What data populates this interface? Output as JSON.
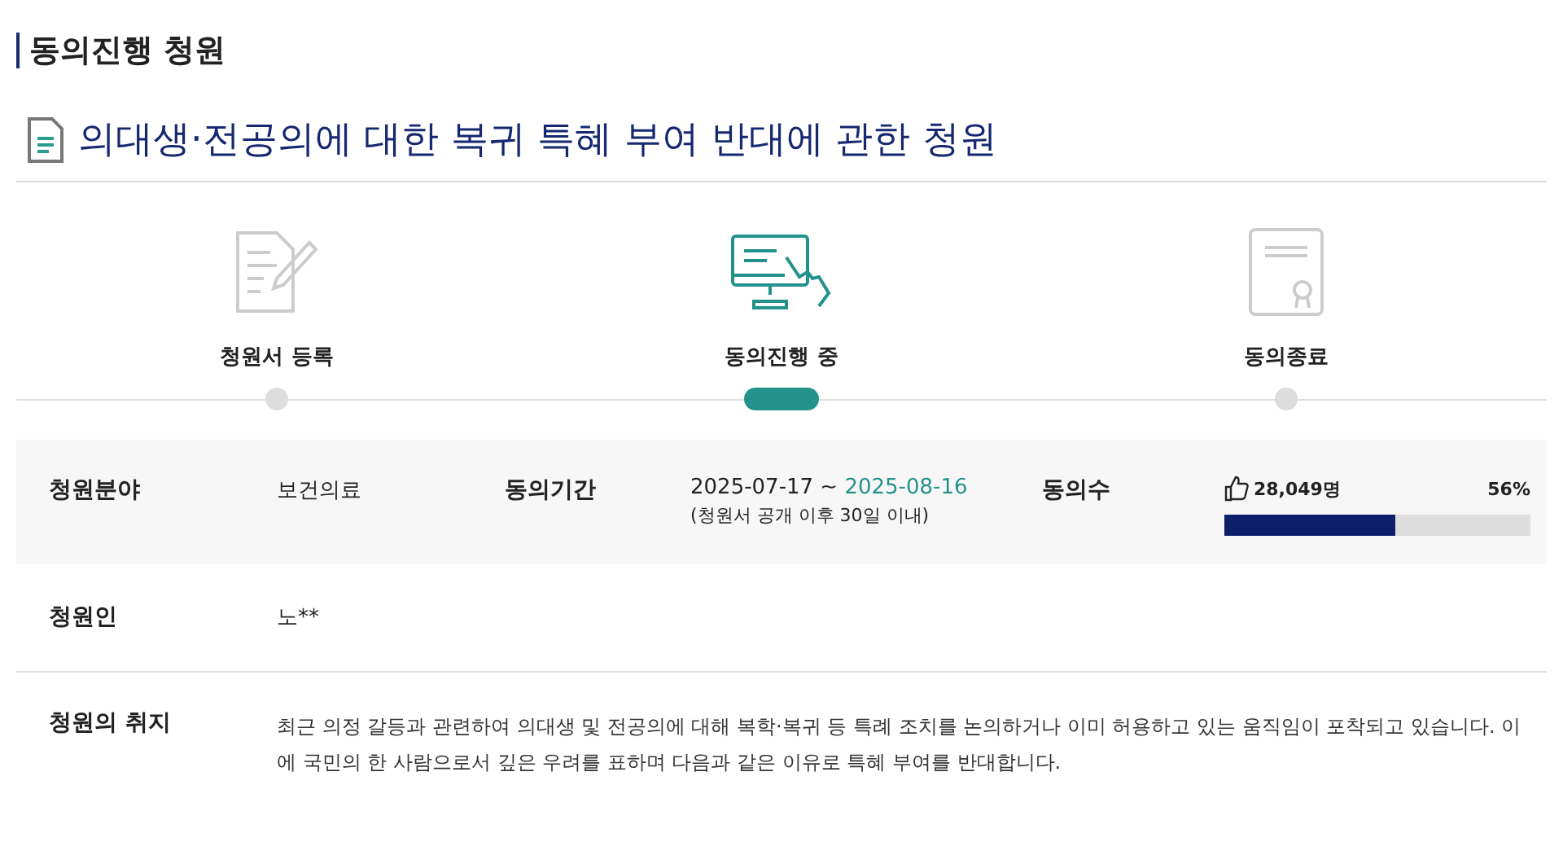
{
  "section_title": "동의진행 청원",
  "petition_title": "의대생·전공의에 대한 복귀 특혜 부여 반대에 관한 청원",
  "steps": [
    {
      "kind": "register",
      "label": "청원서 등록",
      "selected": false
    },
    {
      "kind": "progress",
      "label": "동의진행 중",
      "selected": true
    },
    {
      "kind": "closed",
      "label": "동의종료",
      "selected": false
    }
  ],
  "info": {
    "field_label": "청원분야",
    "field_value": "보건의료",
    "period_label": "동의기간",
    "period_start": "2025-07-17 ~",
    "period_end": "2025-08-16",
    "period_note": "(청원서 공개 이후 30일 이내)",
    "count_label": "동의수",
    "count": "28,049명",
    "percent": "56%",
    "level": 0.56
  },
  "petitioner": {
    "label": "청원인",
    "value": "노**"
  },
  "purpose": {
    "label": "청원의 취지",
    "text": "최근 의정 갈등과 관련하여 의대생 및 전공의에 대해 복학·복귀 등 특례 조치를 논의하거나 이미 허용하고 있는 움직임이 포착되고 있습니다. 이에 국민의 한 사람으로서 깊은 우려를 표하며 다음과 같은 이유로 특혜 부여를 반대합니다."
  }
}
